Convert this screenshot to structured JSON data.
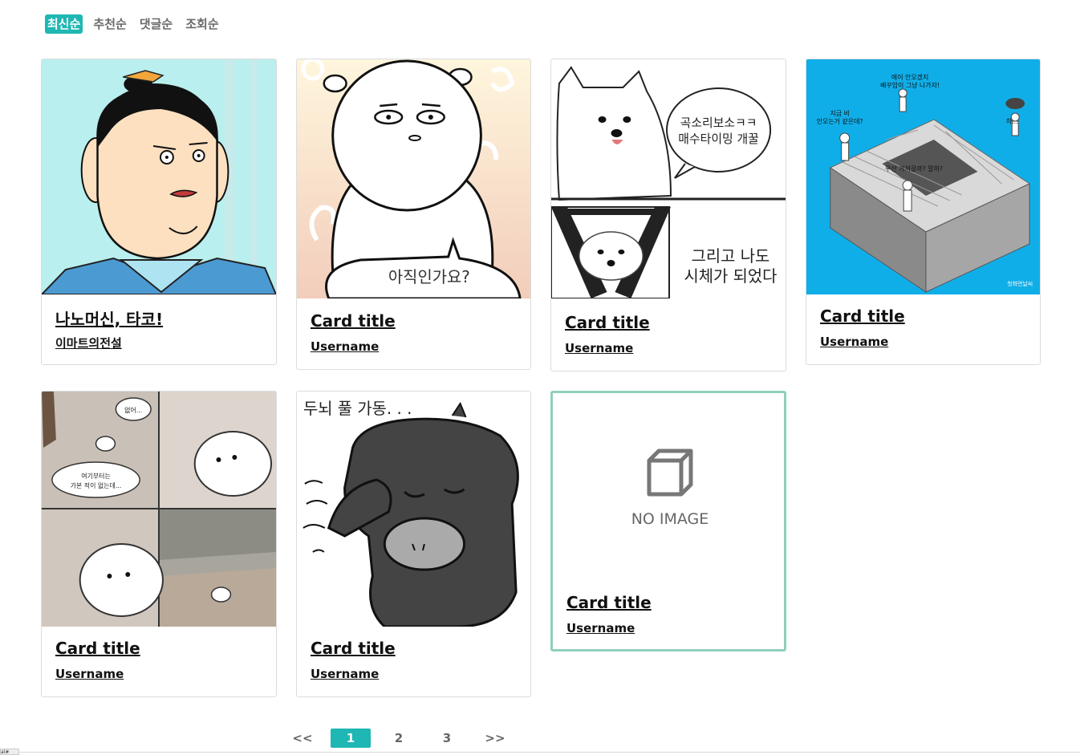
{
  "sort_tabs": [
    "최신순",
    "추천순",
    "댓글순",
    "조회순"
  ],
  "active_tab": 0,
  "cards": [
    {
      "title": "나노머신, 타코!",
      "user": "이마트의전설",
      "image": "bald-man-comic"
    },
    {
      "title": "Card title",
      "user": "Username",
      "image": "bear-speech-comic",
      "speech": "아직인가요?"
    },
    {
      "title": "Card title",
      "user": "Username",
      "image": "white-dog-comic",
      "speech": "곡소리보소ㅋㅋ 매수타이밍 개꿀",
      "caption": "그리고 나도 시체가 되었다"
    },
    {
      "title": "Card title",
      "user": "Username",
      "image": "stairs-illustration",
      "text_top": "에이 안오겠지 배꾸암이 그냥 나가자!",
      "text_left": "지금 비 안오는거 같은데?",
      "text_right": "하...",
      "text_mid": "우산 가져갈까? 말까?",
      "watermark": "첫화먼날씨"
    },
    {
      "title": "Card title",
      "user": "Username",
      "image": "seal-comic",
      "speech1": "없어...",
      "speech2": "여기부터는 가본 적이 없는데..."
    },
    {
      "title": "Card title",
      "user": "Username",
      "image": "black-cow-comic",
      "caption": "두뇌 풀 가동. . ."
    },
    {
      "title": "Card title",
      "user": "Username",
      "image": "no-image-placeholder",
      "placeholder_text": "NO IMAGE"
    }
  ],
  "pagination": {
    "prev": "<<",
    "pages": [
      "1",
      "2",
      "3"
    ],
    "current": "1",
    "next": ">>"
  },
  "corner_label": "al#"
}
